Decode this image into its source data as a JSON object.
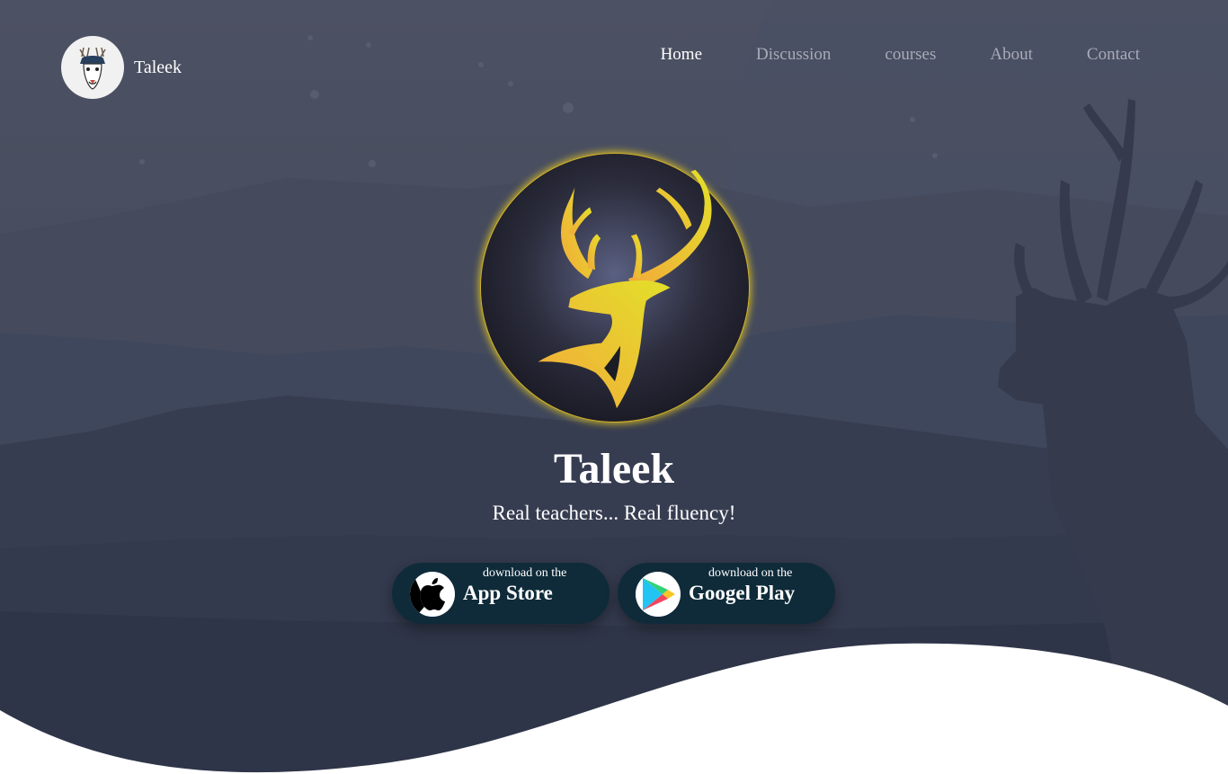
{
  "brand": {
    "name": "Taleek",
    "logo_icon": "deer-logo-icon"
  },
  "nav": {
    "items": [
      {
        "label": "Home",
        "active": true
      },
      {
        "label": "Discussion",
        "active": false
      },
      {
        "label": "courses",
        "active": false
      },
      {
        "label": "About",
        "active": false
      },
      {
        "label": "Contact",
        "active": false
      }
    ]
  },
  "hero": {
    "logo_icon": "golden-deer-icon",
    "title": "Taleek",
    "tagline": "Real teachers... Real fluency!"
  },
  "downloads": {
    "apple": {
      "small": "download on the",
      "big": "App Store",
      "icon": "apple-icon"
    },
    "google": {
      "small": "download on the",
      "big": "Googel Play",
      "icon": "google-play-icon"
    }
  },
  "colors": {
    "background": "#4a4f60",
    "button_bg": "#0f2b3a",
    "gold": "#f2b233",
    "nav_inactive": "#a7abb8",
    "wave": "#ffffff"
  }
}
